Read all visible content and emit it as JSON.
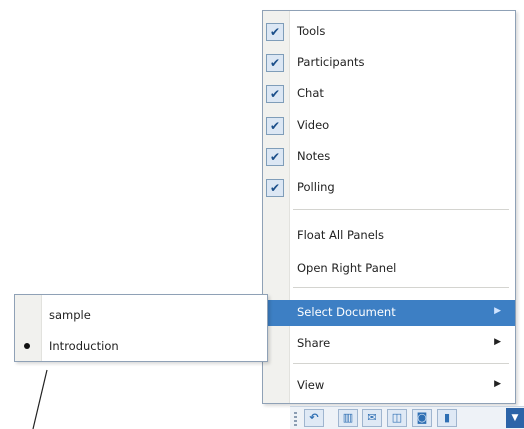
{
  "context_menu": {
    "items": [
      {
        "label": "Tools",
        "checked": true
      },
      {
        "label": "Participants",
        "checked": true
      },
      {
        "label": "Chat",
        "checked": true
      },
      {
        "label": "Video",
        "checked": true
      },
      {
        "label": "Notes",
        "checked": true
      },
      {
        "label": "Polling",
        "checked": true
      },
      {
        "label": "Float All Panels",
        "checked": false
      },
      {
        "label": "Open Right Panel",
        "checked": false
      },
      {
        "label": "Select Document",
        "checked": false,
        "has_submenu": true,
        "highlighted": true
      },
      {
        "label": "Share",
        "checked": false,
        "has_submenu": true
      },
      {
        "label": "View",
        "checked": false,
        "has_submenu": true
      }
    ],
    "check_glyph": "✔",
    "arrow_glyph": "▶"
  },
  "submenu": {
    "items": [
      {
        "label": "sample",
        "selected": false
      },
      {
        "label": "Introduction",
        "selected": true
      }
    ]
  },
  "toolbar": {
    "buttons": [
      {
        "icon": "undo-icon",
        "glyph": "↶"
      },
      {
        "icon": "participants-icon",
        "glyph": "▥"
      },
      {
        "icon": "chat-icon",
        "glyph": "✉"
      },
      {
        "icon": "comment-icon",
        "glyph": "◫"
      },
      {
        "icon": "notes-icon",
        "glyph": "◙"
      },
      {
        "icon": "polling-icon",
        "glyph": "▮"
      }
    ],
    "dropdown_glyph": "▼"
  },
  "colors": {
    "highlight": "#3d7fc4",
    "border": "#8fa1b6",
    "check_bg": "#dce7f4"
  }
}
